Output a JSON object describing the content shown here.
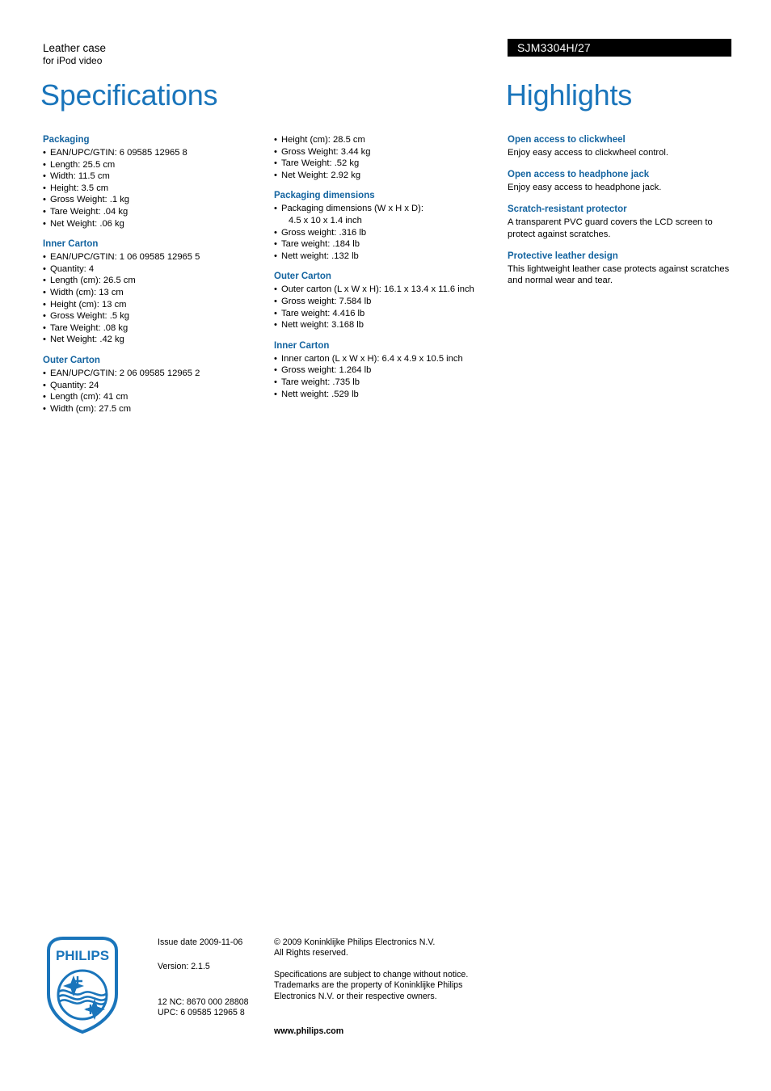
{
  "header": {
    "product_title": "Leather case",
    "product_subtitle": "for iPod video",
    "model_number": "SJM3304H/27"
  },
  "sections": {
    "specifications_title": "Specifications",
    "highlights_title": "Highlights"
  },
  "spec_column_1": [
    {
      "heading": "Packaging",
      "items": [
        "EAN/UPC/GTIN: 6 09585 12965 8",
        "Length: 25.5 cm",
        "Width: 11.5 cm",
        "Height: 3.5 cm",
        "Gross Weight: .1 kg",
        "Tare Weight: .04 kg",
        "Net Weight: .06 kg"
      ]
    },
    {
      "heading": "Inner Carton",
      "items": [
        "EAN/UPC/GTIN: 1 06 09585 12965 5",
        "Quantity: 4",
        "Length (cm): 26.5 cm",
        "Width (cm): 13 cm",
        "Height (cm): 13 cm",
        "Gross Weight: .5 kg",
        "Tare Weight: .08 kg",
        "Net Weight: .42 kg"
      ]
    },
    {
      "heading": "Outer Carton",
      "items": [
        "EAN/UPC/GTIN: 2 06 09585 12965 2",
        "Quantity: 24",
        "Length (cm): 41 cm",
        "Width (cm): 27.5 cm"
      ]
    }
  ],
  "spec_column_2": [
    {
      "heading": "",
      "items": [
        "Height (cm): 28.5 cm",
        "Gross Weight: 3.44 kg",
        "Tare Weight: .52 kg",
        "Net Weight: 2.92 kg"
      ]
    },
    {
      "heading": "Packaging dimensions",
      "items": [
        "Packaging dimensions (W x H x D):",
        "4.5 x 10 x 1.4 inch",
        "Gross weight: .316 lb",
        "Tare weight: .184 lb",
        "Nett weight: .132 lb"
      ],
      "continuation_index": 1
    },
    {
      "heading": "Outer Carton",
      "items": [
        "Outer carton (L x W x H): 16.1 x 13.4 x 11.6 inch",
        "Gross weight: 7.584 lb",
        "Tare weight: 4.416 lb",
        "Nett weight: 3.168 lb"
      ]
    },
    {
      "heading": "Inner Carton",
      "items": [
        "Inner carton (L x W x H): 6.4 x 4.9 x 10.5 inch",
        "Gross weight: 1.264 lb",
        "Tare weight: .735 lb",
        "Nett weight: .529 lb"
      ]
    }
  ],
  "highlights": [
    {
      "heading": "Open access to clickwheel",
      "body": "Enjoy easy access to clickwheel control."
    },
    {
      "heading": "Open access to headphone jack",
      "body": "Enjoy easy access to headphone jack."
    },
    {
      "heading": "Scratch-resistant protector",
      "body": "A transparent PVC guard covers the LCD screen to protect against scratches."
    },
    {
      "heading": "Protective leather design",
      "body": "This lightweight leather case protects against scratches and normal wear and tear."
    }
  ],
  "footer": {
    "logo_wordmark": "PHILIPS",
    "issue_date": "Issue date 2009-11-06",
    "version": "Version: 2.1.5",
    "twelve_nc": "12 NC: 8670 000 28808",
    "upc": "UPC: 6 09585 12965 8",
    "copyright_line_1": "© 2009 Koninklijke Philips Electronics N.V.",
    "copyright_line_2": "All Rights reserved.",
    "disclaimer_line_1": "Specifications are subject to change without notice.",
    "disclaimer_line_2": "Trademarks are the property of Koninklijke Philips",
    "disclaimer_line_3": "Electronics N.V. or their respective owners.",
    "website": "www.philips.com"
  },
  "colors": {
    "heading_blue": "#1a75bb",
    "subheading_blue": "#1464a0",
    "logo_blue": "#1a75bb",
    "model_bar_bg": "#000000"
  }
}
